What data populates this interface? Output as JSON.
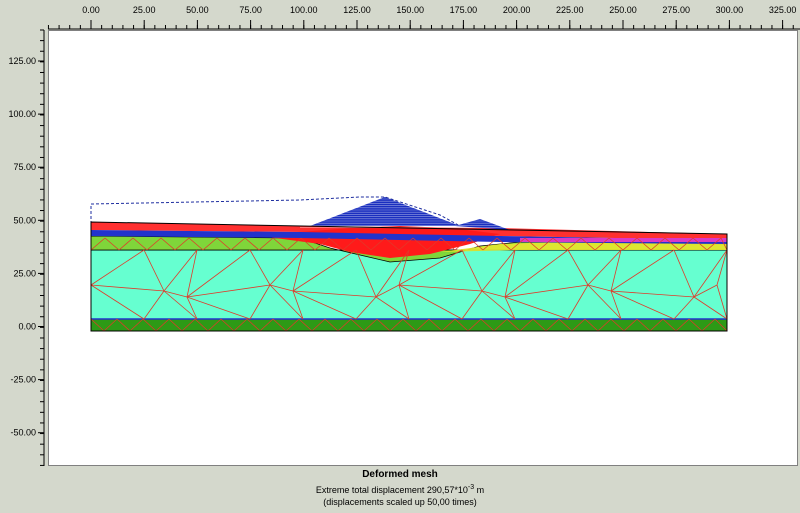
{
  "view": {
    "title": "Deformed mesh",
    "displacement_prefix": "Extreme total displacement 290,57*10",
    "displacement_exponent": "-3",
    "displacement_unit": " m",
    "scale_note": "(displacements scaled up 50,00 times)"
  },
  "rulers": {
    "x_ticks": [
      "0.00",
      "25.00",
      "50.00",
      "75.00",
      "100.00",
      "125.00",
      "150.00",
      "175.00",
      "200.00",
      "225.00",
      "250.00",
      "275.00",
      "300.00",
      "325.00"
    ],
    "y_ticks": [
      "125.00",
      "100.00",
      "75.00",
      "50.00",
      "25.00",
      "0.00",
      "-25.00",
      "-50.00"
    ]
  },
  "colors": {
    "background": "#d4d8cc",
    "plot_background": "#ffffff",
    "mesh_line": "#e03a2a",
    "soil_main": "#66ffd0",
    "soil_bottom": "#2d9a16",
    "soil_green": "#7fd63a",
    "soil_yellow": "#e8e830",
    "embankment": "#1a2fbf",
    "red_zone": "#ff1a1a",
    "surface_blue": "#2233cc",
    "magenta": "#d838c8",
    "outline_dashed": "#1e2ea0"
  }
}
